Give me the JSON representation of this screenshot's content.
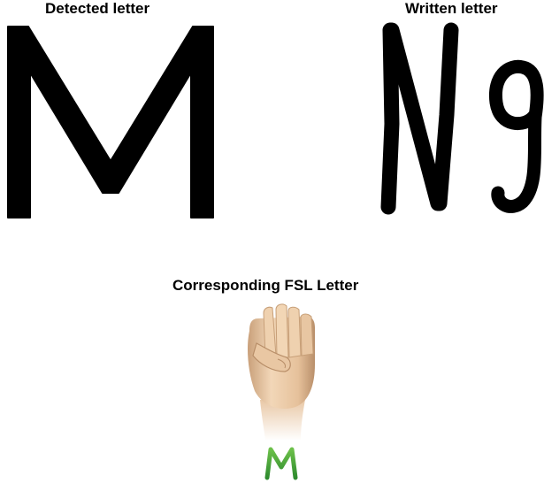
{
  "panels": {
    "detected": {
      "title": "Detected letter",
      "letter": "M"
    },
    "written": {
      "title": "Written letter",
      "letter": "Ng"
    },
    "fsl": {
      "title": "Corresponding FSL Letter",
      "letter": "M"
    }
  },
  "colors": {
    "ink": "#000000",
    "fsl_letter_green": "#3aa035",
    "skin": "#e9c7a3"
  }
}
